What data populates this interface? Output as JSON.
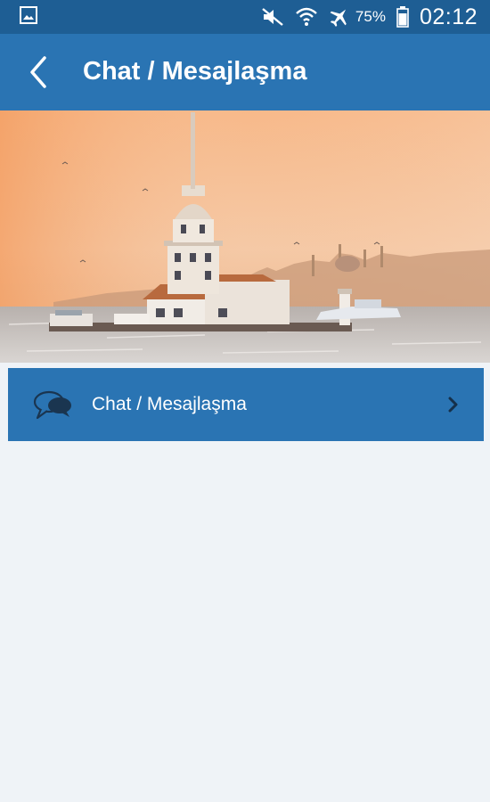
{
  "status_bar": {
    "battery_percent": "75%",
    "time": "02:12",
    "icons": [
      "gallery-icon",
      "mute-icon",
      "wifi-icon",
      "airplane-mode-icon",
      "battery-icon"
    ]
  },
  "header": {
    "title": "Chat / Mesajlaşma",
    "back_icon": "chevron-left-icon"
  },
  "hero": {
    "image": "istanbul-maidens-tower-sunset"
  },
  "menu": {
    "items": [
      {
        "label": "Chat / Mesajlaşma",
        "icon": "chat-bubbles-icon",
        "trailing_icon": "chevron-right-icon"
      }
    ]
  },
  "colors": {
    "status_bar": "#1e5e94",
    "primary": "#2a74b3",
    "background": "#eff3f7"
  }
}
